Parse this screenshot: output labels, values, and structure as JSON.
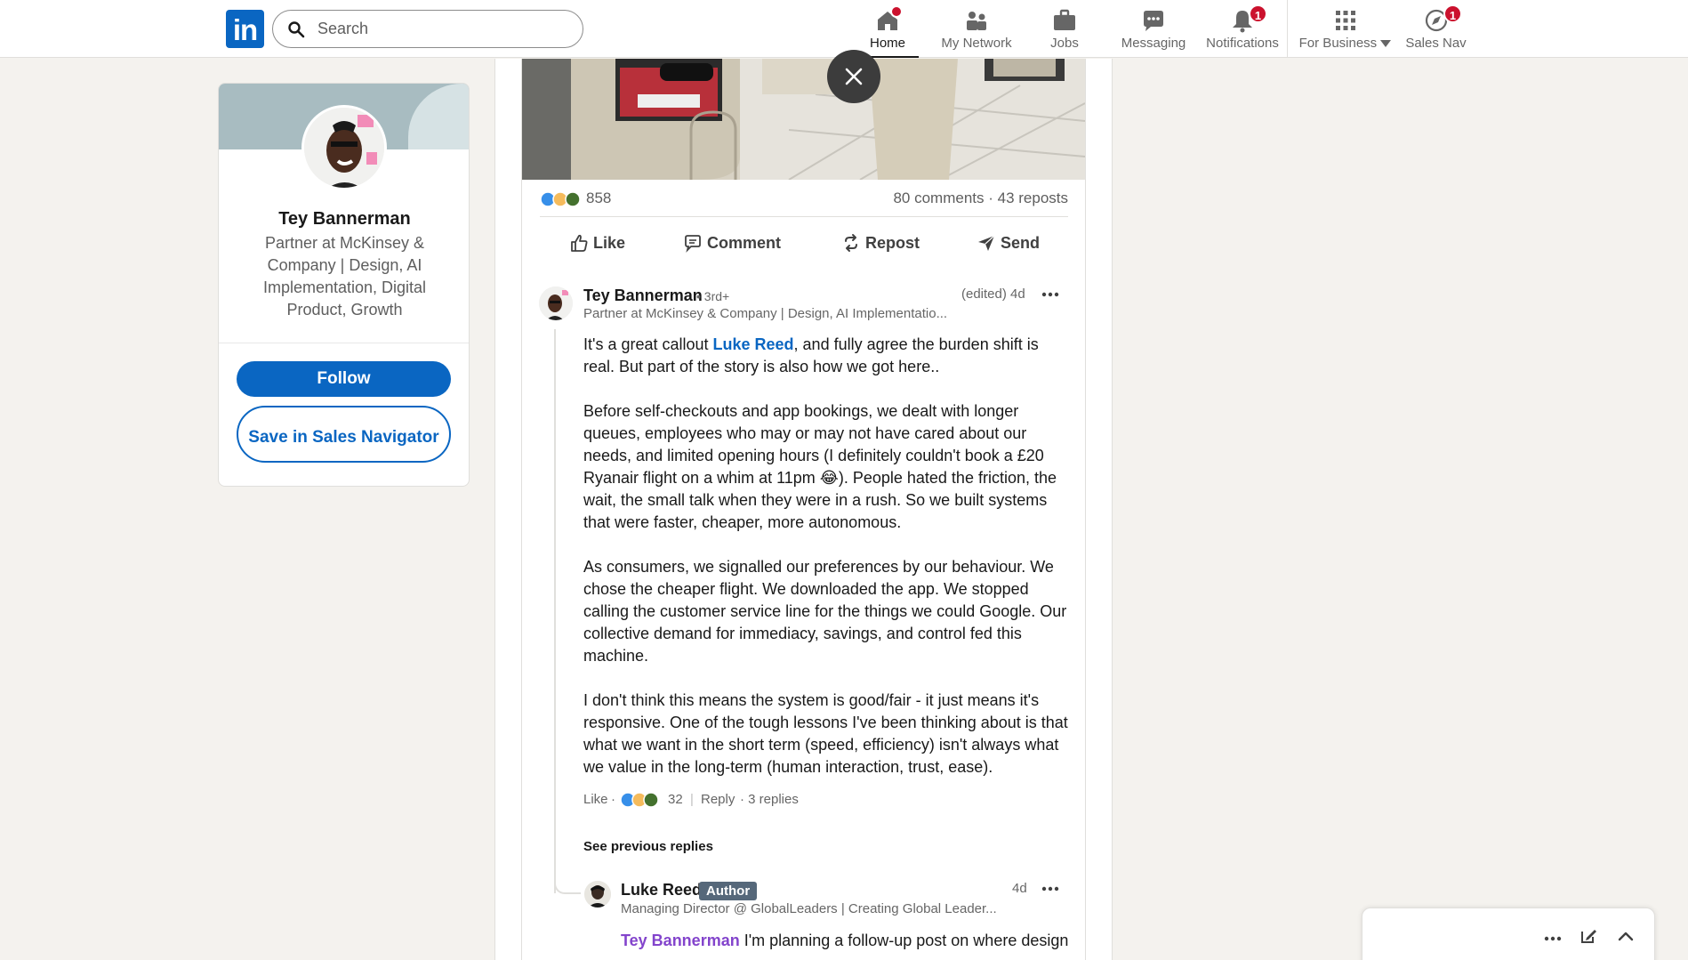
{
  "nav": {
    "search_placeholder": "Search",
    "items": [
      {
        "label": "Home",
        "badge": ""
      },
      {
        "label": "My Network",
        "badge": ""
      },
      {
        "label": "Jobs",
        "badge": ""
      },
      {
        "label": "Messaging",
        "badge": ""
      },
      {
        "label": "Notifications",
        "badge": "1"
      },
      {
        "label": "For Business",
        "badge": ""
      },
      {
        "label": "Sales Nav",
        "badge": "1"
      }
    ]
  },
  "profile": {
    "name": "Tey Bannerman",
    "headline": "Partner at McKinsey & Company | Design, AI Implementation, Digital Product, Growth",
    "follow_label": "Follow",
    "save_label": "Save in Sales Navigator"
  },
  "post": {
    "reaction_count": "858",
    "social_counts": "80 comments · 43 reposts",
    "actions": {
      "like": "Like",
      "comment": "Comment",
      "repost": "Repost",
      "send": "Send"
    }
  },
  "comment": {
    "author": "Tey Bannerman",
    "degree": "• 3rd+",
    "headline": "Partner at McKinsey & Company | Design, AI Implementatio...",
    "time": "(edited) 4d",
    "mention": "Luke Reed",
    "p1_before": "It's a great callout ",
    "p1_after": ", and fully agree the burden shift is real. But part of the story is also how we got here..",
    "p2_before": "Before self-checkouts and app bookings, we dealt with longer queues, employees who may or may not have cared about our needs, and limited opening hours (I definitely couldn't book a £20 Ryanair flight on a whim at 11pm ",
    "p2_emoji": "😂",
    "p2_after": "). People hated the friction, the wait, the small talk when they were in a rush. So we built systems that were faster, cheaper, more autonomous.",
    "p3": "As consumers, we signalled our preferences by our behaviour. We chose the cheaper flight. We downloaded the app. We stopped calling the customer service line for the things we could Google. Our collective demand for immediacy, savings, and control fed this machine.",
    "p4": "I don't think this means the system is good/fair - it just means it's responsive. One of the tough lessons I've been thinking about is that what we want in the short term (speed, efficiency) isn't always what we value in the long-term (human interaction, trust, ease).",
    "like_label": "Like",
    "dot": "·",
    "reaction_count": "32",
    "sep": "|",
    "reply_label": "Reply",
    "replies_count": "· 3 replies",
    "see_previous": "See previous replies"
  },
  "reply": {
    "author": "Luke Reed",
    "badge": "Author",
    "headline": "Managing Director @ GlobalLeaders | Creating Global Leader...",
    "time": "4d",
    "mention": "Tey Bannerman",
    "text": " I'm planning a follow-up post on where design"
  },
  "colors": {
    "brand": "#0a66c2",
    "badge": "#cb112d",
    "author_badge": "#56687a",
    "reply_mention": "#8344cc"
  }
}
